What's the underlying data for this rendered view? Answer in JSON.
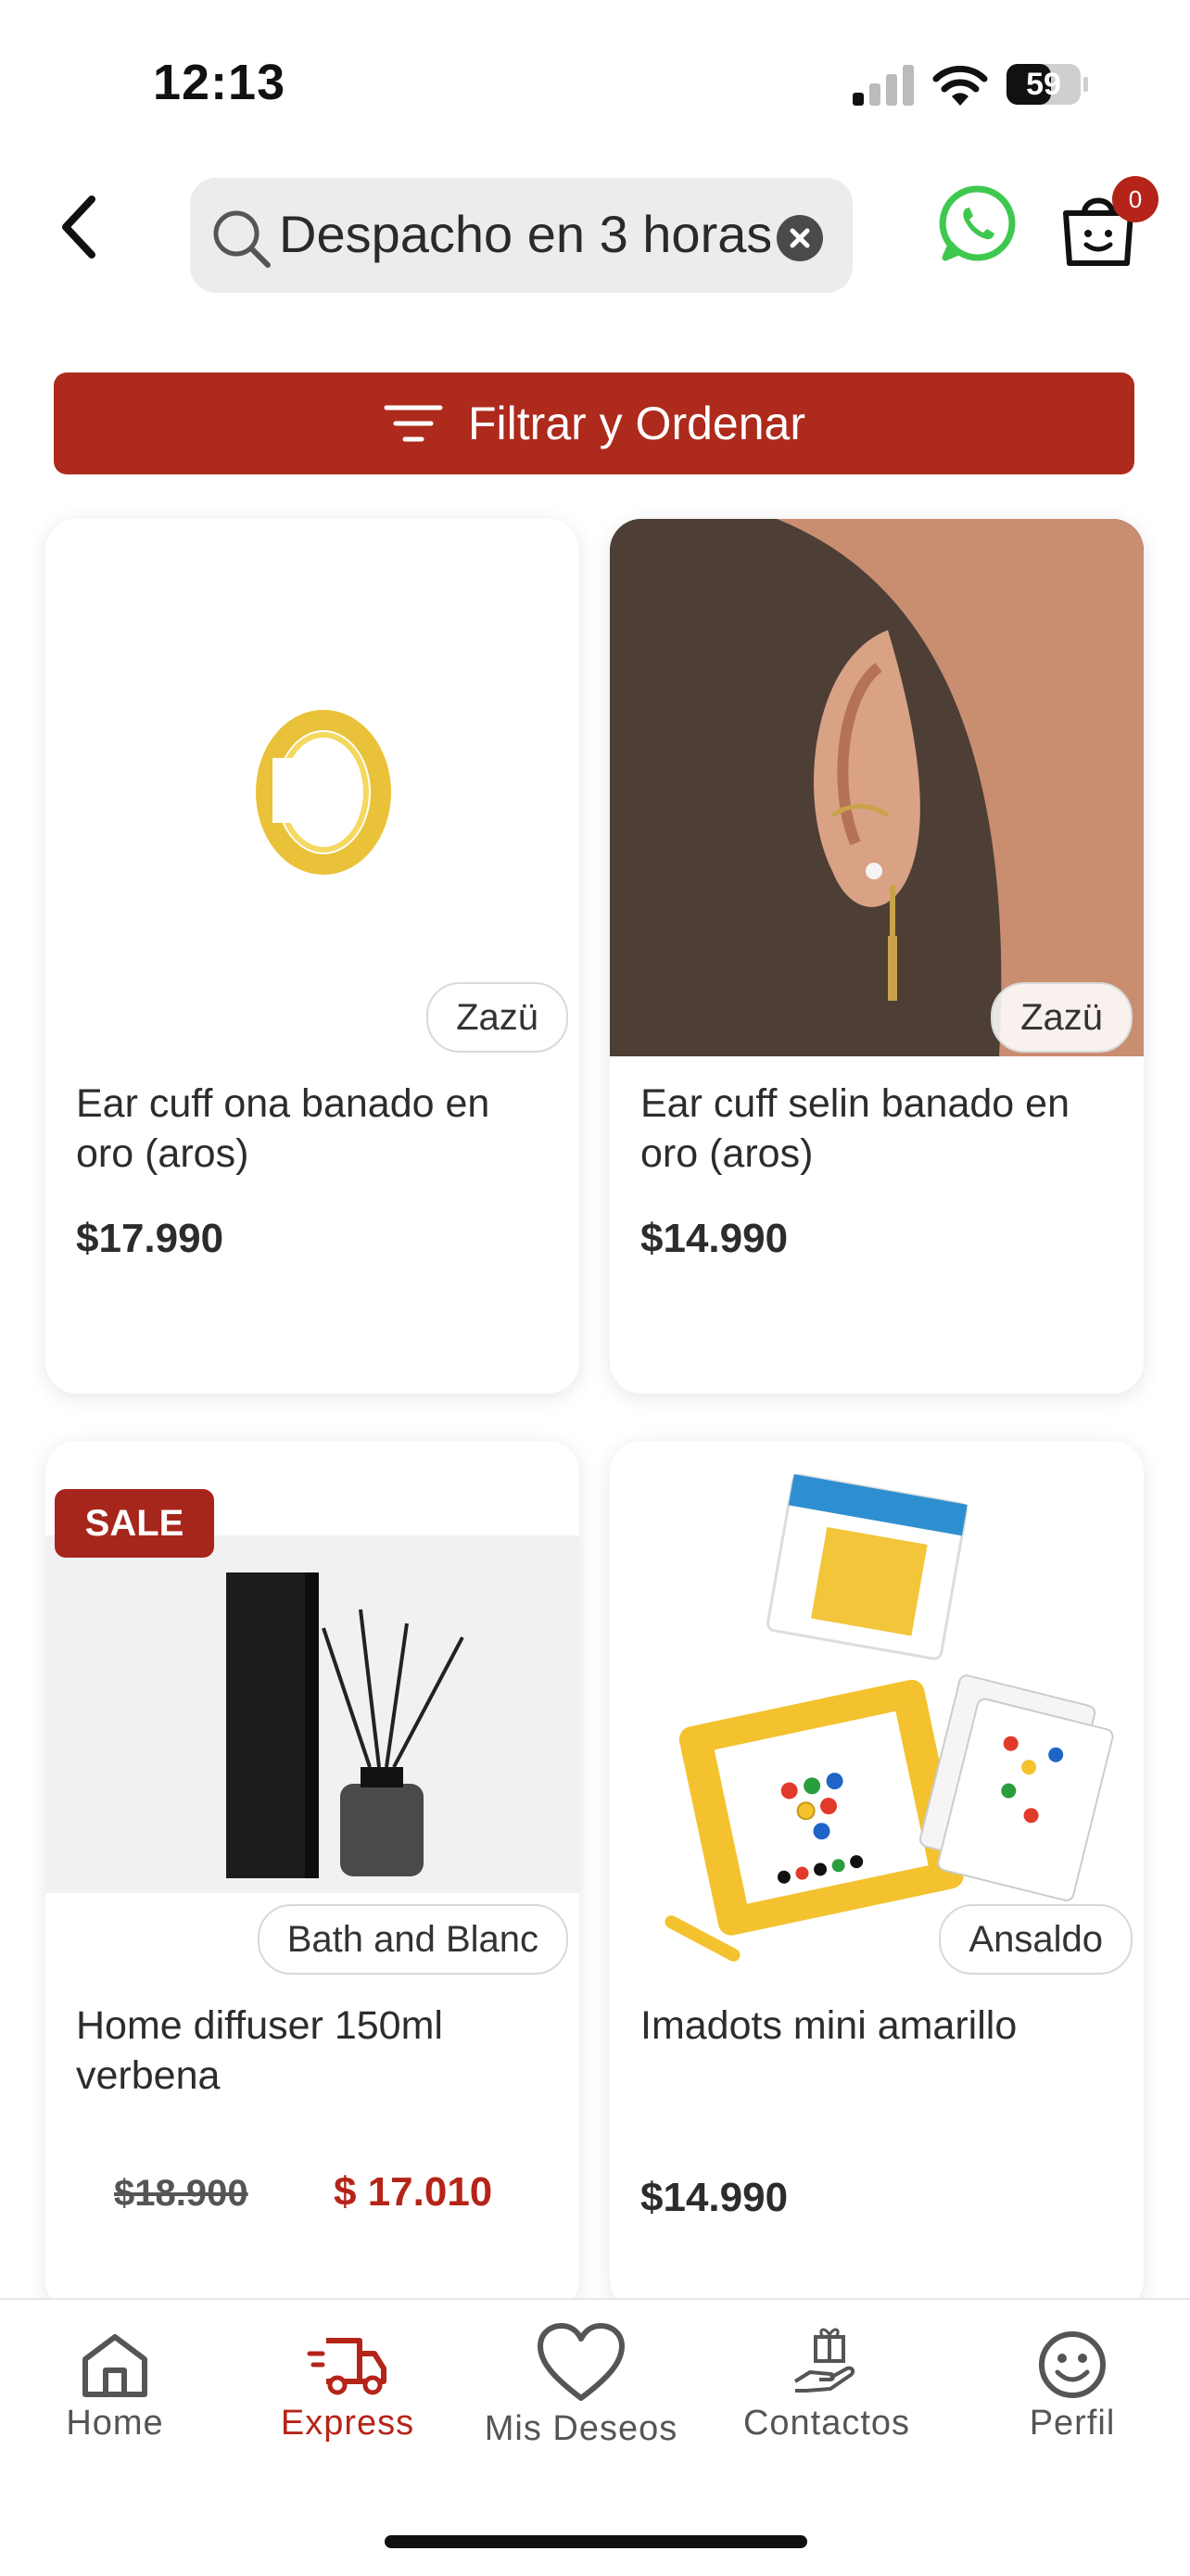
{
  "status_bar": {
    "time": "12:13",
    "battery": "59"
  },
  "header": {
    "search_value": "Despacho en 3 horas",
    "cart_count": "0"
  },
  "filter": {
    "label": "Filtrar y Ordenar"
  },
  "products": [
    {
      "brand": "Zazü",
      "name": "Ear cuff ona banado en oro (aros)",
      "price": "$17.990"
    },
    {
      "brand": "Zazü",
      "name": "Ear cuff selin banado en oro (aros)",
      "price": "$14.990"
    },
    {
      "badge": "SALE",
      "brand": "Bath and Blanc",
      "name": "Home diffuser 150ml verbena",
      "old_price": "$18.900",
      "sale_price": "$ 17.010"
    },
    {
      "brand": "Ansaldo",
      "name": "Imadots mini amarillo",
      "price": "$14.990"
    }
  ],
  "bottom_nav": [
    {
      "label": "Home",
      "icon": "home-icon"
    },
    {
      "label": "Express",
      "icon": "delivery-truck-icon",
      "active": true
    },
    {
      "label": "Mis Deseos",
      "icon": "heart-icon"
    },
    {
      "label": "Contactos",
      "icon": "gift-hand-icon"
    },
    {
      "label": "Perfil",
      "icon": "smiley-icon"
    }
  ],
  "colors": {
    "accent": "#ad2a1c",
    "sale_price": "#b52418",
    "whatsapp": "#3fc84f"
  }
}
